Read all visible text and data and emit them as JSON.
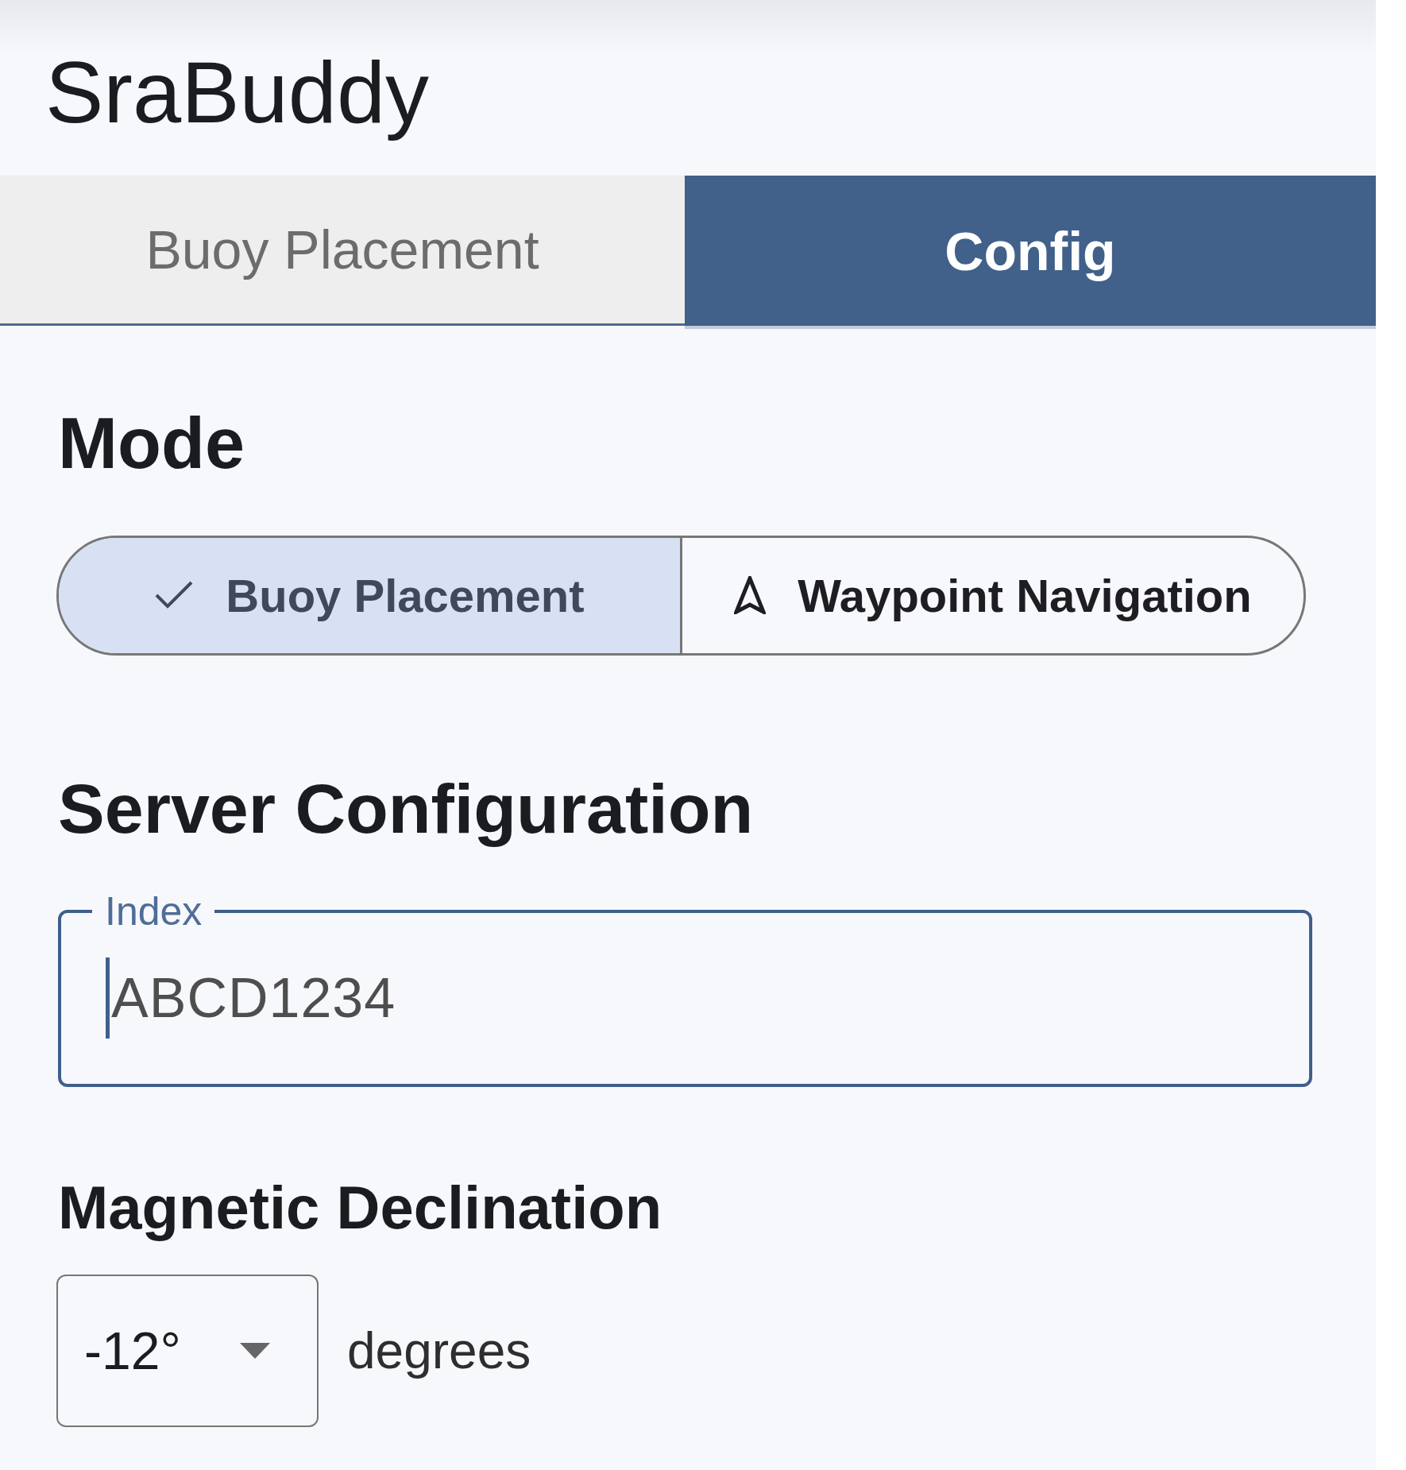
{
  "app_title": "SraBuddy",
  "tabs": [
    {
      "label": "Buoy Placement",
      "selected": false
    },
    {
      "label": "Config",
      "selected": true
    }
  ],
  "mode": {
    "heading": "Mode",
    "options": [
      {
        "label": "Buoy Placement",
        "selected": true
      },
      {
        "label": "Waypoint Navigation",
        "selected": false
      }
    ]
  },
  "server_configuration": {
    "heading": "Server Configuration",
    "fields": [
      {
        "label": "Index",
        "value": "ABCD1234",
        "focused": true
      }
    ]
  },
  "magnetic_declination": {
    "heading": "Magnetic Declination",
    "select": {
      "value": "-12°"
    },
    "unit": "degrees"
  }
}
